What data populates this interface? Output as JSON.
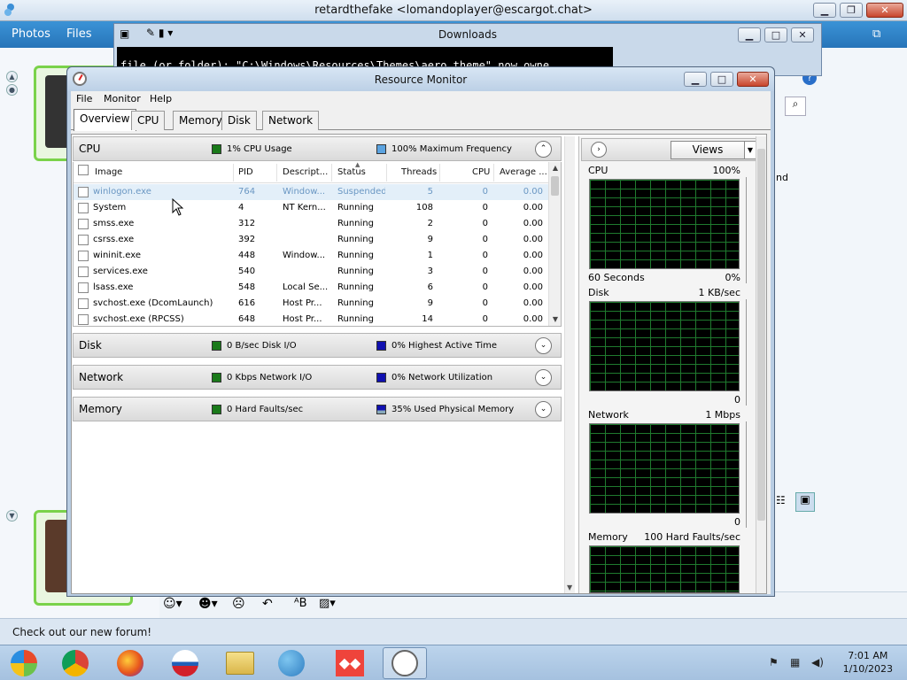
{
  "messenger": {
    "title": "retardthefake <lomandoplayer@escargot.chat>",
    "nav": [
      "Photos",
      "Files"
    ],
    "status_text": "Check out our new forum!",
    "partial_text": "nd"
  },
  "downloads": {
    "title": "Downloads",
    "console_text": "file (or folder): \"C:\\Windows\\Resources\\Themes\\aero.theme\" now owne"
  },
  "resmon": {
    "title": "Resource Monitor",
    "menu": [
      "File",
      "Monitor",
      "Help"
    ],
    "tabs": [
      "Overview",
      "CPU",
      "Memory",
      "Disk",
      "Network"
    ],
    "active_tab": "Overview",
    "panels": {
      "cpu": {
        "name": "CPU",
        "legend1": "1% CPU Usage",
        "legend2": "100% Maximum Frequency",
        "color1": "#1a7a1a",
        "color2": "#5ba3e0"
      },
      "disk": {
        "name": "Disk",
        "legend1": "0 B/sec Disk I/O",
        "legend2": "0% Highest Active Time",
        "color1": "#1a7a1a",
        "color2": "#1010b0"
      },
      "network": {
        "name": "Network",
        "legend1": "0 Kbps Network I/O",
        "legend2": "0% Network Utilization",
        "color1": "#1a7a1a",
        "color2": "#1010b0"
      },
      "memory": {
        "name": "Memory",
        "legend1": "0 Hard Faults/sec",
        "legend2": "35% Used Physical Memory",
        "color1": "#1a7a1a",
        "color2": "#1010b0"
      }
    },
    "process_columns": [
      "Image",
      "PID",
      "Descript...",
      "Status",
      "Threads",
      "CPU",
      "Average ..."
    ],
    "processes": [
      {
        "image": "winlogon.exe",
        "pid": "764",
        "desc": "Window...",
        "status": "Suspended",
        "threads": "5",
        "cpu": "0",
        "avg": "0.00"
      },
      {
        "image": "System",
        "pid": "4",
        "desc": "NT Kern...",
        "status": "Running",
        "threads": "108",
        "cpu": "0",
        "avg": "0.00"
      },
      {
        "image": "smss.exe",
        "pid": "312",
        "desc": "",
        "status": "Running",
        "threads": "2",
        "cpu": "0",
        "avg": "0.00"
      },
      {
        "image": "csrss.exe",
        "pid": "392",
        "desc": "",
        "status": "Running",
        "threads": "9",
        "cpu": "0",
        "avg": "0.00"
      },
      {
        "image": "wininit.exe",
        "pid": "448",
        "desc": "Window...",
        "status": "Running",
        "threads": "1",
        "cpu": "0",
        "avg": "0.00"
      },
      {
        "image": "services.exe",
        "pid": "540",
        "desc": "",
        "status": "Running",
        "threads": "3",
        "cpu": "0",
        "avg": "0.00"
      },
      {
        "image": "lsass.exe",
        "pid": "548",
        "desc": "Local Se...",
        "status": "Running",
        "threads": "6",
        "cpu": "0",
        "avg": "0.00"
      },
      {
        "image": "svchost.exe (DcomLaunch)",
        "pid": "616",
        "desc": "Host Pr...",
        "status": "Running",
        "threads": "9",
        "cpu": "0",
        "avg": "0.00"
      },
      {
        "image": "svchost.exe (RPCSS)",
        "pid": "648",
        "desc": "Host Pr...",
        "status": "Running",
        "threads": "14",
        "cpu": "0",
        "avg": "0.00"
      }
    ],
    "views_label": "Views",
    "graphs": [
      {
        "name": "CPU",
        "max": "100%",
        "bottom_left": "60 Seconds",
        "bottom_right": "0%"
      },
      {
        "name": "Disk",
        "max": "1 KB/sec",
        "bottom_left": "",
        "bottom_right": "0"
      },
      {
        "name": "Network",
        "max": "1 Mbps",
        "bottom_left": "",
        "bottom_right": "0"
      },
      {
        "name": "Memory",
        "max": "100 Hard Faults/sec",
        "bottom_left": "",
        "bottom_right": ""
      }
    ]
  },
  "taskbar": {
    "time": "7:01 AM",
    "date": "1/10/2023"
  }
}
